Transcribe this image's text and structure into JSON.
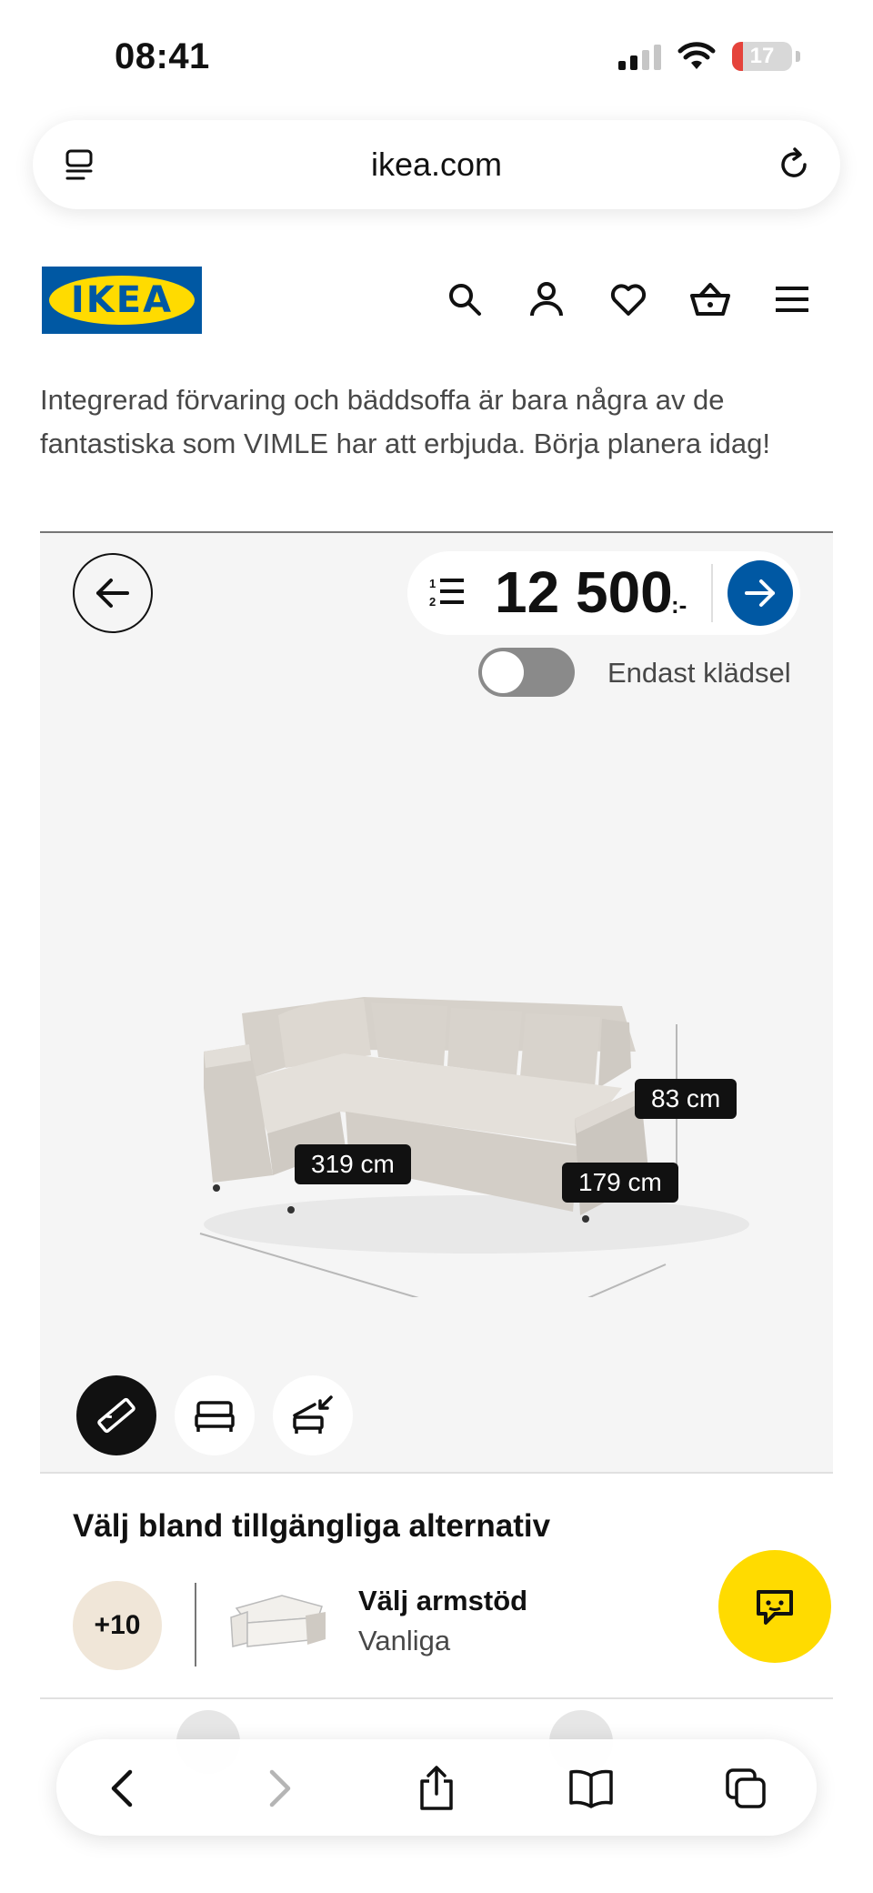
{
  "status_bar": {
    "time": "08:41",
    "battery": "17"
  },
  "browser": {
    "url": "ikea.com"
  },
  "header": {
    "logo_text": "IKEA"
  },
  "intro_text": "Integrerad förvaring och bäddsoffa är bara några av de fantastiska som VIMLE har att erbjuda. Börja planera idag!",
  "configurator": {
    "price": "12 500",
    "price_suffix": ":-",
    "toggle_label": "Endast klädsel",
    "toggle_on": false,
    "dimensions": {
      "width": "319 cm",
      "depth": "179 cm",
      "height": "83 cm"
    },
    "colors": {
      "accent": "#0058a3",
      "brand_yellow": "#ffdb00"
    }
  },
  "options": {
    "title": "Välj bland tillgängliga alternativ",
    "count_badge": "+10",
    "armrest_title": "Välj armstöd",
    "armrest_value": "Vanliga"
  }
}
